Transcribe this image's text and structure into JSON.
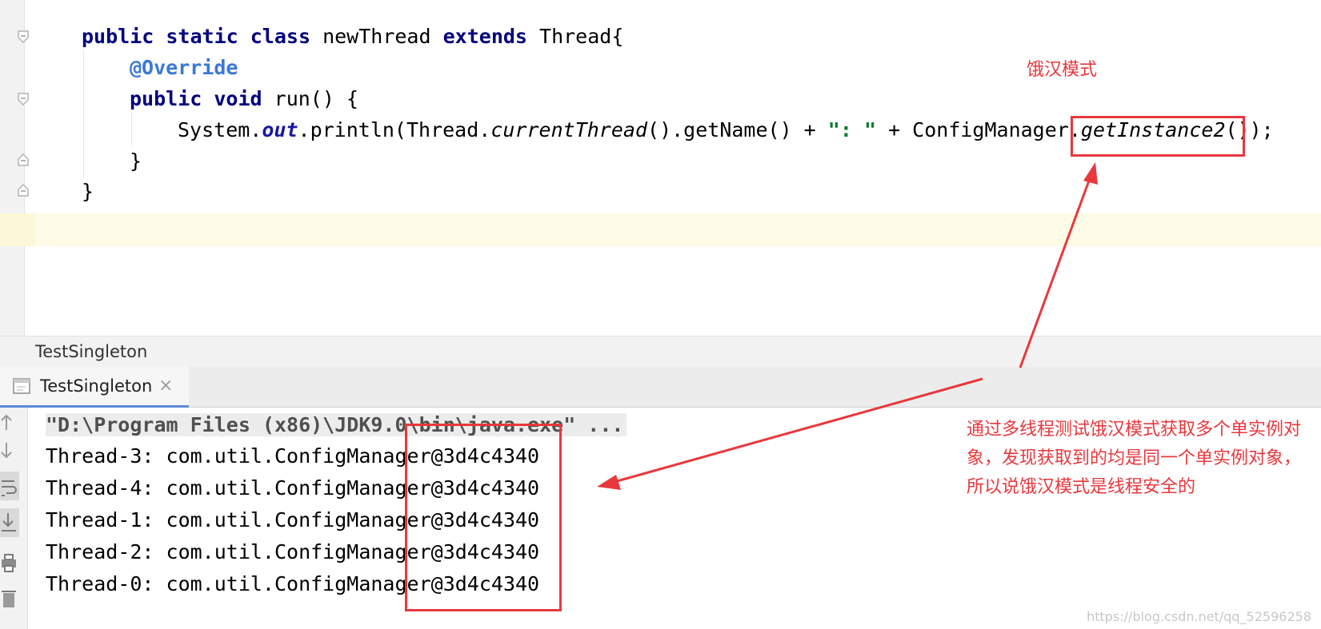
{
  "editor": {
    "lines": {
      "l1": {
        "kw1": "public",
        "kw2": "static",
        "kw3": "class",
        "name": "newThread",
        "kw4": "extends",
        "rest": "Thread{"
      },
      "l2": {
        "annotation": "@Override"
      },
      "l3": {
        "kw1": "public",
        "kw2": "void",
        "rest": "run() {"
      },
      "l4": {
        "p1": "System.",
        "field": "out",
        "p2": ".println(Thread.",
        "m1": "currentThread",
        "p3": "().getName() + ",
        "str": "\": \"",
        "p4": " + ConfigManager.",
        "m2": "getInstance2",
        "p5": "());"
      },
      "l5": {
        "text": "}"
      },
      "l6": {
        "text": "}"
      }
    }
  },
  "breadcrumb": {
    "label": "TestSingleton"
  },
  "run_panel": {
    "tab": {
      "label": "TestSingleton",
      "close": "×"
    },
    "console": {
      "command": "\"D:\\Program Files (x86)\\JDK9.0\\bin\\java.exe\" ...",
      "lines": [
        "Thread-3: com.util.ConfigManager@3d4c4340",
        "Thread-4: com.util.ConfigManager@3d4c4340",
        "Thread-1: com.util.ConfigManager@3d4c4340",
        "Thread-2: com.util.ConfigManager@3d4c4340",
        "Thread-0: com.util.ConfigManager@3d4c4340"
      ]
    }
  },
  "annotations": {
    "title": "饿汉模式",
    "body": "通过多线程测试饿汉模式获取多个单实例对象，发现获取到的均是同一个单实例对象，所以说饿汉模式是线程安全的",
    "color": "#e8383d"
  },
  "watermark": "https://blog.csdn.net/qq_52596258"
}
